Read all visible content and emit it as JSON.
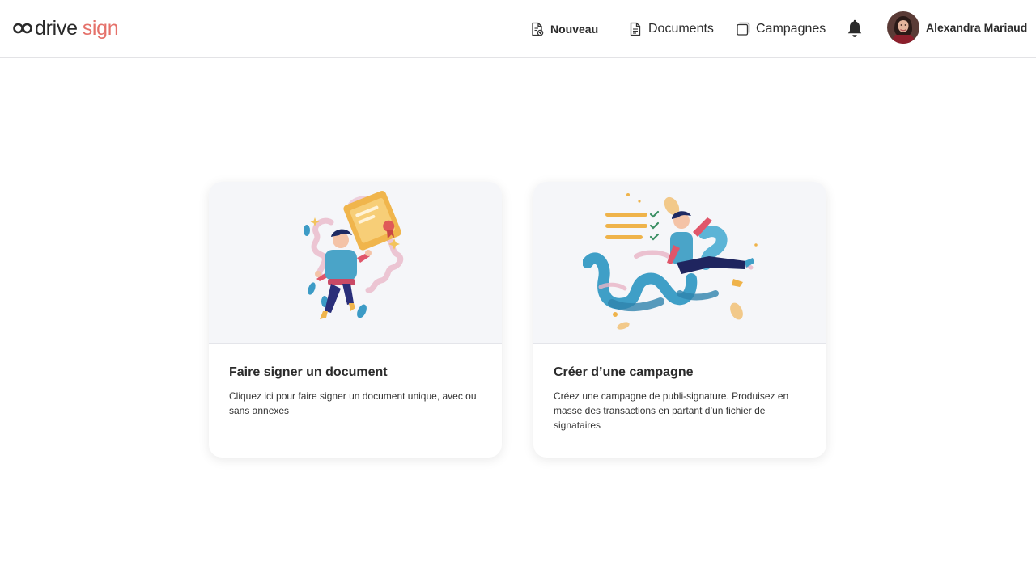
{
  "brand": {
    "part1": "drive",
    "part2": "sign",
    "accent": "#e5716a",
    "logo_icon": "infinity-loop-icon"
  },
  "nav": {
    "new_label": "Nouveau",
    "documents_label": "Documents",
    "campaigns_label": "Campagnes",
    "notifications_icon": "bell-icon"
  },
  "user": {
    "name": "Alexandra Mariaud"
  },
  "cards": [
    {
      "title": "Faire signer un document",
      "description": "Cliquez ici pour faire signer un document unique, avec ou sans annexes",
      "illustration": "person-with-certificate-illustration"
    },
    {
      "title": "Créer d’une campagne",
      "description": "Créez une campagne de publi-signature. Produisez en masse des transactions en partant d’un fichier de signataires",
      "illustration": "person-with-scroll-checklist-illustration"
    }
  ],
  "colors": {
    "background": "#ffffff",
    "card_illustration_bg": "#f5f6f9",
    "text": "#2b2b2b"
  }
}
